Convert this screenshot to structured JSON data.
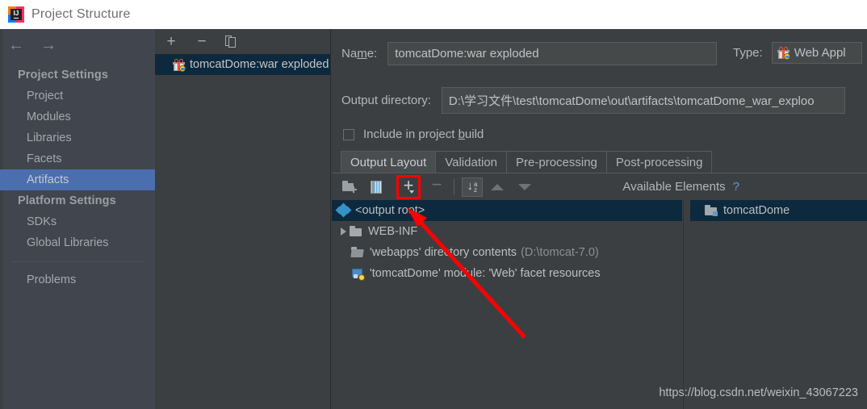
{
  "window": {
    "title": "Project Structure",
    "app_icon": "intellij-idea-icon"
  },
  "sidebar": {
    "back_icon": "arrow-left-icon",
    "forward_icon": "arrow-right-icon",
    "groups": [
      {
        "label": "Project Settings",
        "items": [
          {
            "label": "Project",
            "selected": false
          },
          {
            "label": "Modules",
            "selected": false
          },
          {
            "label": "Libraries",
            "selected": false
          },
          {
            "label": "Facets",
            "selected": false
          },
          {
            "label": "Artifacts",
            "selected": true
          }
        ]
      },
      {
        "label": "Platform Settings",
        "items": [
          {
            "label": "SDKs",
            "selected": false
          },
          {
            "label": "Global Libraries",
            "selected": false
          }
        ]
      }
    ],
    "problems": "Problems",
    "selection_color": "#4b6eaf"
  },
  "artifacts_panel": {
    "toolbar": {
      "add_label": "+",
      "remove_label": "−",
      "copy_icon": "copy-icon"
    },
    "items": [
      {
        "label": "tomcatDome:war exploded",
        "icon": "war-exploded-artifact-icon",
        "selected": true
      }
    ]
  },
  "main": {
    "name_label": "Name:",
    "name_label_pre": "Na",
    "name_label_mnemonic": "m",
    "name_label_post": "e:",
    "name_value": "tomcatDome:war exploded",
    "type_label": "Type:",
    "type_value": "Web Appl",
    "type_icon": "war-exploded-artifact-icon",
    "output_dir_label": "Output directory:",
    "output_dir_value": "D:\\学习文件\\test\\tomcatDome\\out\\artifacts\\tomcatDome_war_exploo",
    "include_checkbox": {
      "checked": false,
      "label_pre": "Include in project ",
      "label_mnemonic": "b",
      "label_post": "uild"
    },
    "tabs": [
      {
        "label": "Output Layout",
        "active": true
      },
      {
        "label": "Validation",
        "active": false
      },
      {
        "label": "Pre-processing",
        "active": false
      },
      {
        "label": "Post-processing",
        "active": false
      }
    ],
    "layout_toolbar": {
      "create_directory_icon": "folder-add-icon",
      "create_archive_icon": "archive-add-icon",
      "add_label": "+",
      "add_caret_icon": "chevron-down-icon",
      "remove_label": "−",
      "sort_icon": "sort-alphabetical-icon",
      "move_up_icon": "triangle-up-icon",
      "move_down_icon": "triangle-down-icon",
      "highlight_color": "#ff0000"
    },
    "available_elements": {
      "title": "Available Elements",
      "help_icon": "question-mark-icon",
      "items": [
        {
          "label": "tomcatDome",
          "icon": "module-folder-icon",
          "selected": true
        }
      ]
    },
    "output_tree": [
      {
        "label": "<output root>",
        "icon": "output-root-icon",
        "selected": true,
        "indent": 0,
        "expander": false
      },
      {
        "label": "WEB-INF",
        "icon": "folder-icon",
        "selected": false,
        "indent": 0,
        "expander": true
      },
      {
        "label": "'webapps' directory contents",
        "suffix": "(D:\\tomcat-7.0)",
        "icon": "folder-open-icon",
        "selected": false,
        "indent": 1,
        "expander": false
      },
      {
        "label": "'tomcatDome' module: 'Web' facet resources",
        "icon": "web-facet-icon",
        "selected": false,
        "indent": 1,
        "expander": false
      }
    ]
  },
  "watermark": "https://blog.csdn.net/weixin_43067223"
}
